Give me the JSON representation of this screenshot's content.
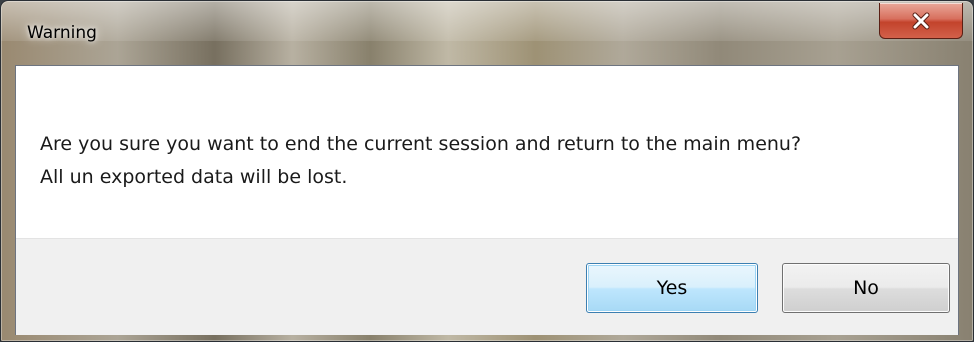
{
  "window": {
    "title": "Warning",
    "close_icon": "close-icon"
  },
  "message": {
    "line1": "Are you sure you want to end the current session and return to the main menu?",
    "line2": "All un exported data will be lost."
  },
  "buttons": {
    "yes_label": "Yes",
    "no_label": "No"
  },
  "colors": {
    "close_button": "#c3432c",
    "default_button_border": "#3c7fb1",
    "button_area_bg": "#f0f0f0"
  }
}
